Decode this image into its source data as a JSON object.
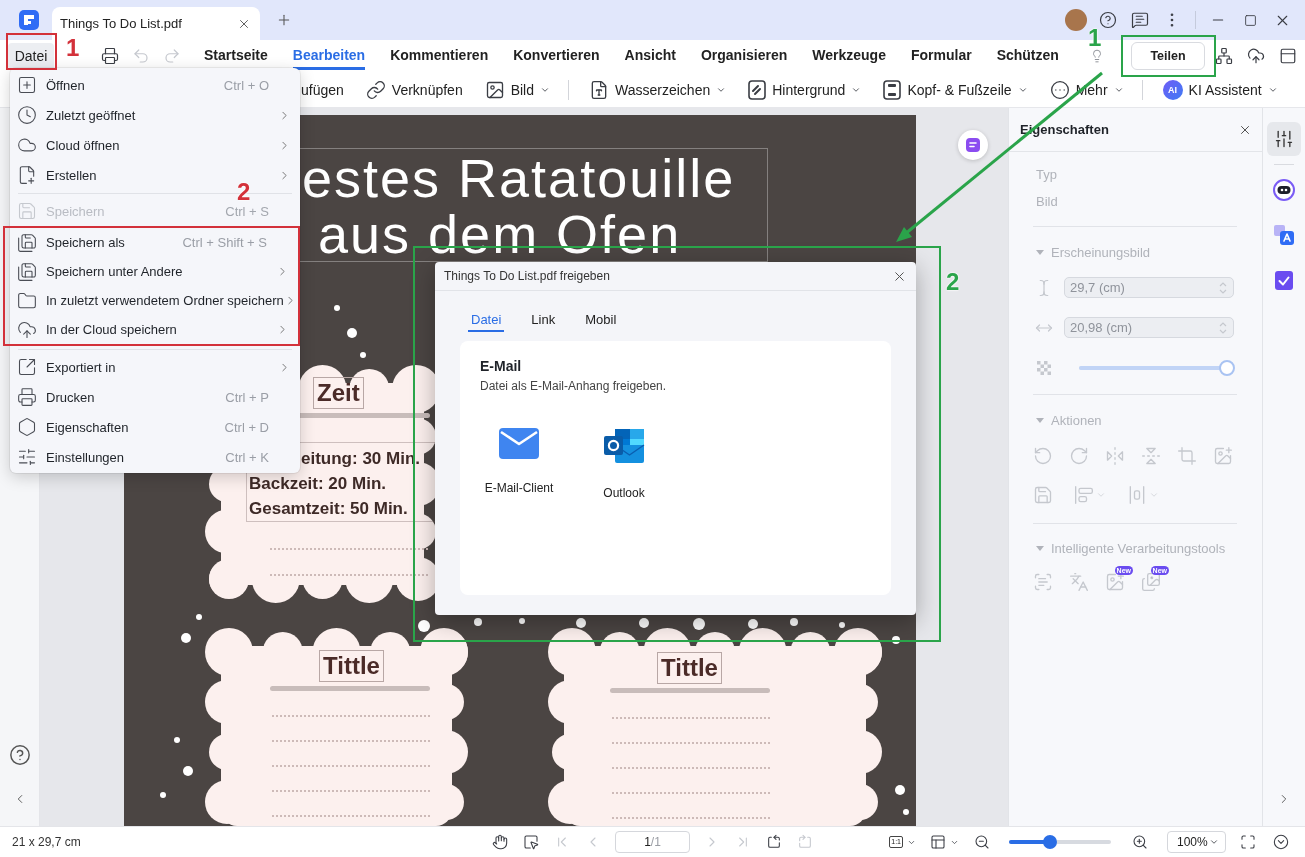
{
  "window": {
    "tab_title": "Things To Do List.pdf"
  },
  "menu_bar": {
    "file_button": "Datei",
    "quick_actions": [
      {
        "kind": "print",
        "disabled": false
      },
      {
        "kind": "undo",
        "disabled": true
      },
      {
        "kind": "redo",
        "disabled": true
      }
    ],
    "tabs": [
      {
        "label": "Startseite",
        "selected": false
      },
      {
        "label": "Bearbeiten",
        "selected": true
      },
      {
        "label": "Kommentieren",
        "selected": false
      },
      {
        "label": "Konvertieren",
        "selected": false
      },
      {
        "label": "Ansicht",
        "selected": false
      },
      {
        "label": "Organisieren",
        "selected": false
      },
      {
        "label": "Werkzeuge",
        "selected": false
      },
      {
        "label": "Formular",
        "selected": false
      },
      {
        "label": "Schützen",
        "selected": false
      }
    ],
    "share_button": "Teilen"
  },
  "toolbar": {
    "groups": [
      [
        {
          "label": "ufügen",
          "dropdown": false
        },
        {
          "label": "Verknüpfen",
          "dropdown": false
        },
        {
          "label": "Bild",
          "dropdown": true
        }
      ],
      [
        {
          "label": "Wasserzeichen",
          "dropdown": true
        },
        {
          "label": "Hintergrund",
          "dropdown": true
        },
        {
          "label": "Kopf- & Fußzeile",
          "dropdown": true
        },
        {
          "label": "Mehr",
          "dropdown": true
        }
      ]
    ],
    "assistant": {
      "badge": "AI",
      "label": "KI Assistent",
      "dropdown": true
    }
  },
  "file_menu": {
    "groups": [
      [
        {
          "label": "Öffnen",
          "shortcut": "Ctrl + O",
          "submenu": false,
          "disabled": false
        },
        {
          "label": "Zuletzt geöffnet",
          "submenu": true,
          "disabled": false
        },
        {
          "label": "Cloud öffnen",
          "submenu": true,
          "disabled": false
        },
        {
          "label": "Erstellen",
          "submenu": true,
          "disabled": false
        }
      ],
      [
        {
          "label": "Speichern",
          "shortcut": "Ctrl + S",
          "submenu": false,
          "disabled": true
        },
        {
          "label": "Speichern als",
          "shortcut": "Ctrl + Shift + S",
          "submenu": false,
          "disabled": false
        },
        {
          "label": "Speichern unter Andere",
          "submenu": true,
          "disabled": false
        },
        {
          "label": "In zuletzt verwendetem Ordner speichern",
          "submenu": true,
          "disabled": false
        },
        {
          "label": "In der Cloud speichern",
          "submenu": true,
          "disabled": false
        }
      ],
      [
        {
          "label": "Exportiert in",
          "submenu": true,
          "disabled": false
        },
        {
          "label": "Drucken",
          "shortcut": "Ctrl + P",
          "submenu": false,
          "disabled": false
        },
        {
          "label": "Eigenschaften",
          "shortcut": "Ctrl + D",
          "submenu": false,
          "disabled": false
        },
        {
          "label": "Einstellungen",
          "shortcut": "Ctrl + K",
          "submenu": false,
          "disabled": false
        }
      ]
    ]
  },
  "document": {
    "title_lines": [
      "estes Ratatouille",
      "aus dem Ofen"
    ],
    "time_card": {
      "heading": "Zeit",
      "lines": [
        "eitung: 30 Min.",
        "Backzeit: 20 Min.",
        "Gesamtzeit: 50 Min."
      ]
    },
    "cards": [
      {
        "heading": "Tittle"
      },
      {
        "heading": "Tittle"
      }
    ]
  },
  "share_dialog": {
    "title": "Things To Do List.pdf freigeben",
    "tabs": [
      {
        "label": "Datei",
        "selected": true
      },
      {
        "label": "Link",
        "selected": false
      },
      {
        "label": "Mobil",
        "selected": false
      }
    ],
    "section_title": "E-Mail",
    "section_description": "Datei als E-Mail-Anhang freigeben.",
    "options": [
      {
        "kind": "mail_client",
        "label": "E-Mail-Client"
      },
      {
        "kind": "outlook",
        "label": "Outlook"
      }
    ]
  },
  "properties_panel": {
    "title": "Eigenschaften",
    "disabled": true,
    "type_label": "Typ",
    "type_value": "Bild",
    "appearance": {
      "heading": "Erscheinungsbild",
      "expanded": true,
      "height": "29,7 (cm)",
      "width": "20,98 (cm)",
      "opacity": {
        "level": 1
      }
    },
    "actions": {
      "heading": "Aktionen",
      "expanded": true
    },
    "smart_tools": {
      "heading": "Intelligente Verarbeitungstools",
      "expanded": true,
      "tools": [
        {
          "kind": "text_scan"
        },
        {
          "kind": "translate"
        },
        {
          "kind": "image",
          "badge": "New"
        },
        {
          "kind": "images",
          "badge": "New"
        }
      ]
    }
  },
  "side_tools": [
    {
      "kind": "properties",
      "selected": true
    },
    {
      "kind": "assistant",
      "selected": false
    },
    {
      "kind": "translate",
      "selected": false
    },
    {
      "kind": "tasks",
      "selected": false
    }
  ],
  "status_bar": {
    "page_size": "21 x 29,7 cm",
    "nav": [
      {
        "kind": "hand",
        "disabled": false
      },
      {
        "kind": "select",
        "disabled": false
      },
      {
        "kind": "first",
        "disabled": true
      },
      {
        "kind": "previous",
        "disabled": true
      },
      {
        "kind": "page",
        "current": "1",
        "total": "/1"
      },
      {
        "kind": "next",
        "disabled": true
      },
      {
        "kind": "last",
        "disabled": true
      },
      {
        "kind": "rotate_left",
        "disabled": false
      },
      {
        "kind": "rotate_right",
        "disabled": true
      }
    ],
    "fit_label": "1:1",
    "zoom": {
      "level": 0.4
    },
    "zoom_value": "100%"
  },
  "annotations": [
    {
      "number": "1",
      "color": "#d3313a"
    },
    {
      "number": "2",
      "color": "#d3313a"
    },
    {
      "number": "1",
      "color": "#2aa44a"
    },
    {
      "number": "2",
      "color": "#2aa44a"
    }
  ]
}
